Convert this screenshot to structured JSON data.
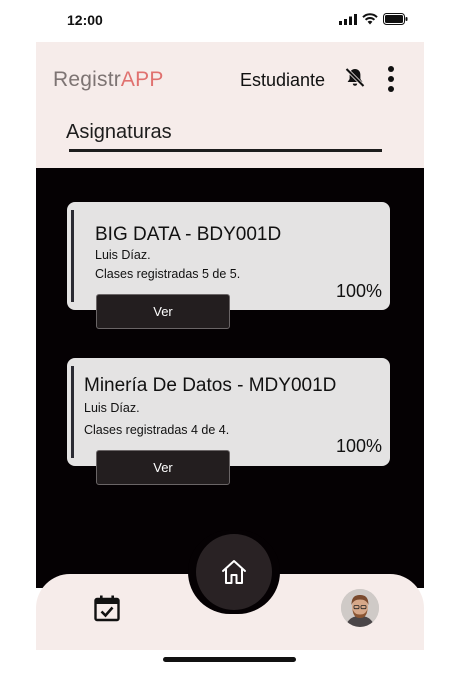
{
  "status_bar": {
    "time": "12:00"
  },
  "header": {
    "brand_prefix": "Registr",
    "brand_accent": "APP",
    "role": "Estudiante",
    "bell_icon": "bell-off-icon",
    "menu_icon": "more-vertical-icon"
  },
  "section": {
    "title": "Asignaturas"
  },
  "courses": [
    {
      "title": "BIG DATA - BDY001D",
      "teacher": "Luis Díaz.",
      "classes": "Clases registradas 5 de 5.",
      "percent": "100%",
      "button": "Ver"
    },
    {
      "title": "Minería De Datos - MDY001D",
      "teacher": "Luis Díaz.",
      "classes": "Clases registradas 4 de 4.",
      "percent": "100%",
      "button": "Ver"
    }
  ],
  "tabbar": {
    "left_icon": "calendar-check-icon",
    "center_icon": "home-icon",
    "right_icon": "avatar"
  },
  "colors": {
    "accent": "#e0716f",
    "header_bg": "#f6ecea",
    "content_bg": "#050103",
    "card_bg": "#e4e3e3",
    "button_bg": "#231e1f"
  }
}
